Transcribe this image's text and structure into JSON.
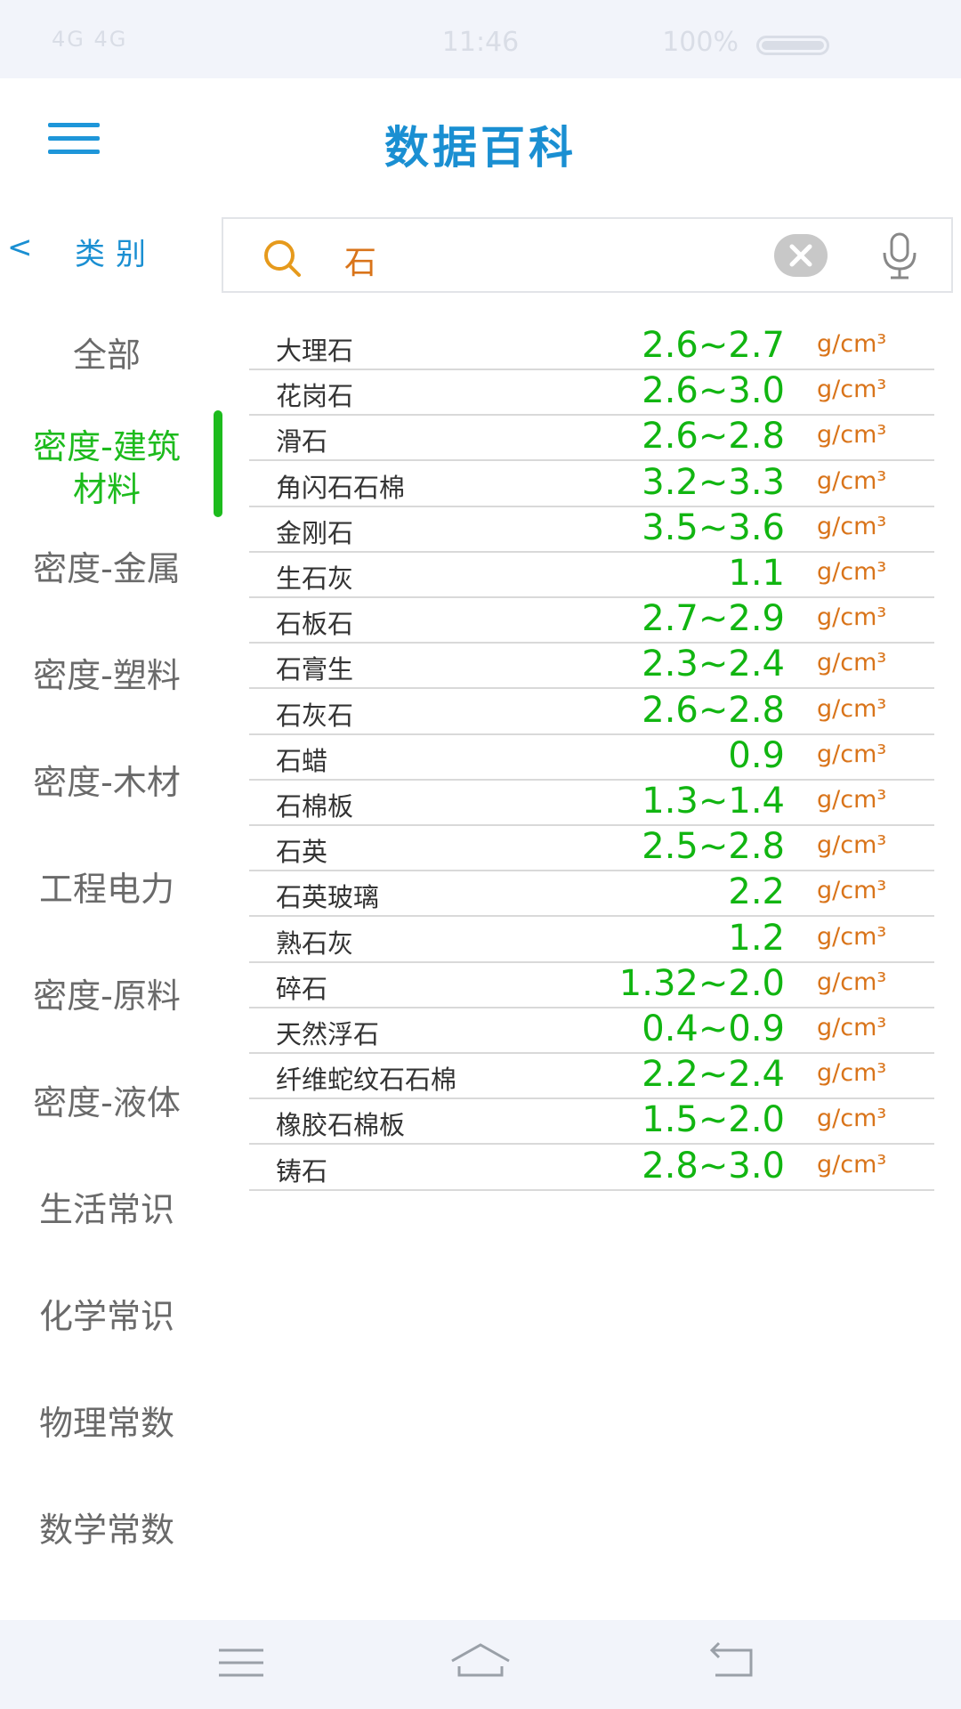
{
  "status_bar": {
    "signal": "4G 4G",
    "time": "11:46",
    "right_text": "100%"
  },
  "header": {
    "title": "数据百科"
  },
  "category_nav": {
    "back_arrow": "<",
    "label": "类别"
  },
  "search": {
    "value": "石",
    "icon": "search-icon",
    "clear_icon": "clear-icon",
    "mic_icon": "microphone-icon"
  },
  "sidebar": {
    "items": [
      {
        "label": "全部",
        "active": false
      },
      {
        "label": "密度-建筑材料",
        "line1": "密度-建筑",
        "line2": "材料",
        "active": true
      },
      {
        "label": "密度-金属",
        "active": false
      },
      {
        "label": "密度-塑料",
        "active": false
      },
      {
        "label": "密度-木材",
        "active": false
      },
      {
        "label": "工程电力",
        "active": false
      },
      {
        "label": "密度-原料",
        "active": false
      },
      {
        "label": "密度-液体",
        "active": false
      },
      {
        "label": "生活常识",
        "active": false
      },
      {
        "label": "化学常识",
        "active": false
      },
      {
        "label": "物理常数",
        "active": false
      },
      {
        "label": "数学常数",
        "active": false
      }
    ]
  },
  "table": {
    "unit": "g/cm³",
    "rows": [
      {
        "name": "大理石",
        "value": "2.6~2.7"
      },
      {
        "name": "花岗石",
        "value": "2.6~3.0"
      },
      {
        "name": "滑石",
        "value": "2.6~2.8"
      },
      {
        "name": "角闪石石棉",
        "value": "3.2~3.3"
      },
      {
        "name": "金刚石",
        "value": "3.5~3.6"
      },
      {
        "name": "生石灰",
        "value": "1.1"
      },
      {
        "name": "石板石",
        "value": "2.7~2.9"
      },
      {
        "name": "石膏生",
        "value": "2.3~2.4"
      },
      {
        "name": "石灰石",
        "value": "2.6~2.8"
      },
      {
        "name": "石蜡",
        "value": "0.9"
      },
      {
        "name": "石棉板",
        "value": "1.3~1.4"
      },
      {
        "name": "石英",
        "value": "2.5~2.8"
      },
      {
        "name": "石英玻璃",
        "value": "2.2"
      },
      {
        "name": "熟石灰",
        "value": "1.2"
      },
      {
        "name": "碎石",
        "value": "1.32~2.0"
      },
      {
        "name": "天然浮石",
        "value": "0.4~0.9"
      },
      {
        "name": "纤维蛇纹石石棉",
        "value": "2.2~2.4"
      },
      {
        "name": "橡胶石棉板",
        "value": "1.5~2.0"
      },
      {
        "name": "铸石",
        "value": "2.8~3.0"
      }
    ]
  },
  "colors": {
    "brand_blue": "#1a8fd2",
    "active_green": "#1dbb1d",
    "value_green": "#11b511",
    "unit_orange": "#d9741a"
  },
  "nav_bar": {
    "icons": [
      "menu-icon",
      "home-icon",
      "back-icon"
    ]
  }
}
